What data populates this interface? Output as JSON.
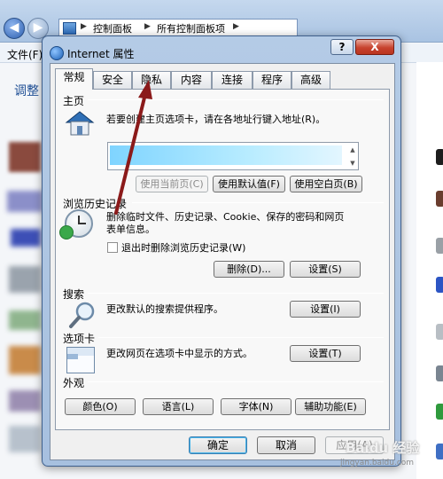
{
  "explorer": {
    "breadcrumb": [
      "控制面板",
      "所有控制面板项"
    ],
    "menu_file": "文件(F)",
    "left_link": "调整"
  },
  "dialog": {
    "title": "Internet 属性",
    "help_label": "?",
    "close_label": "X",
    "tabs": [
      {
        "label": "常规",
        "active": true
      },
      {
        "label": "安全",
        "active": false
      },
      {
        "label": "隐私",
        "active": false
      },
      {
        "label": "内容",
        "active": false
      },
      {
        "label": "连接",
        "active": false
      },
      {
        "label": "程序",
        "active": false
      },
      {
        "label": "高级",
        "active": false
      }
    ],
    "homepage": {
      "title": "主页",
      "description": "若要创建主页选项卡，请在各地址行键入地址(R)。",
      "btn_current": "使用当前页(C)",
      "btn_default": "使用默认值(F)",
      "btn_blank": "使用空白页(B)"
    },
    "history": {
      "title": "浏览历史记录",
      "description_line1": "删除临时文件、历史记录、Cookie、保存的密码和网页",
      "description_line2": "表单信息。",
      "checkbox_label": "退出时删除浏览历史记录(W)",
      "checkbox_checked": false,
      "btn_delete": "删除(D)...",
      "btn_settings": "设置(S)"
    },
    "search": {
      "title": "搜索",
      "description": "更改默认的搜索提供程序。",
      "btn_settings": "设置(I)"
    },
    "tabs_section": {
      "title": "选项卡",
      "description": "更改网页在选项卡中显示的方式。",
      "btn_settings": "设置(T)"
    },
    "appearance": {
      "title": "外观",
      "btn_colors": "颜色(O)",
      "btn_languages": "语言(L)",
      "btn_fonts": "字体(N)",
      "btn_accessibility": "辅助功能(E)"
    },
    "footer": {
      "ok": "确定",
      "cancel": "取消",
      "apply": "应用(A)"
    }
  },
  "annotation": {
    "arrow_color": "#8b1a1a",
    "points_to": "隐私"
  },
  "watermark": {
    "brand": "Baidu 经验",
    "url": "jingyan.baidu.com"
  }
}
